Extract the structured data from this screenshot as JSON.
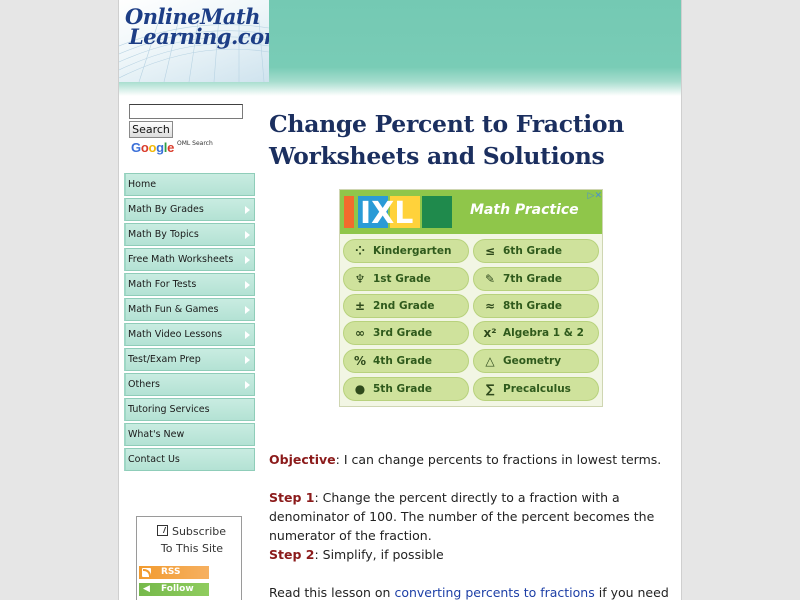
{
  "header": {
    "logo_line1": "OnlineMath",
    "logo_line2": "Learning.com"
  },
  "search": {
    "input_value": "",
    "placeholder": "",
    "button_label": "Search",
    "google_letters": [
      "G",
      "o",
      "o",
      "g",
      "l",
      "e"
    ],
    "google_sub": "OML Search"
  },
  "nav": {
    "items": [
      {
        "label": "Home",
        "has_arrow": false
      },
      {
        "label": "Math By Grades",
        "has_arrow": true
      },
      {
        "label": "Math By Topics",
        "has_arrow": true
      },
      {
        "label": "Free Math Worksheets",
        "has_arrow": true
      },
      {
        "label": "Math For Tests",
        "has_arrow": true
      },
      {
        "label": "Math Fun & Games",
        "has_arrow": true
      },
      {
        "label": "Math Video Lessons",
        "has_arrow": true
      },
      {
        "label": "Test/Exam Prep",
        "has_arrow": true
      },
      {
        "label": "Others",
        "has_arrow": true
      },
      {
        "label": "Tutoring Services",
        "has_arrow": false
      },
      {
        "label": "What's New",
        "has_arrow": false
      },
      {
        "label": "Contact Us",
        "has_arrow": false
      }
    ]
  },
  "subscribe": {
    "line1": "Subscribe",
    "line2": "To This Site",
    "rss_label": "RSS",
    "follow_label": "Follow"
  },
  "main": {
    "title_line1": "Change Percent to Fraction",
    "title_line2": "Worksheets and Solutions"
  },
  "ad": {
    "brand": "IXL",
    "title": "Math Practice",
    "choices_icon": "▷✕",
    "colors": {
      "header": "#8fc64a",
      "cell": "#cfe29c",
      "cell_text": "#2f5a1c"
    },
    "left": [
      {
        "icon": "dots-icon",
        "glyph": "⁘",
        "label": "Kindergarten"
      },
      {
        "icon": "crayons-icon",
        "glyph": "♆",
        "label": "1st Grade"
      },
      {
        "icon": "plus-minus-icon",
        "glyph": "±",
        "label": "2nd Grade"
      },
      {
        "icon": "infinity-icon",
        "glyph": "∞",
        "label": "3rd Grade"
      },
      {
        "icon": "percent-icon",
        "glyph": "%",
        "label": "4th Grade"
      },
      {
        "icon": "apple-icon",
        "glyph": "●",
        "label": "5th Grade"
      }
    ],
    "right": [
      {
        "icon": "less-equal-icon",
        "glyph": "≤",
        "label": "6th Grade"
      },
      {
        "icon": "pencil-icon",
        "glyph": "✎",
        "label": "7th Grade"
      },
      {
        "icon": "approx-icon",
        "glyph": "≈",
        "label": "8th Grade"
      },
      {
        "icon": "x-squared-icon",
        "glyph": "x²",
        "label": "Algebra 1 & 2"
      },
      {
        "icon": "triangle-icon",
        "glyph": "△",
        "label": "Geometry"
      },
      {
        "icon": "sigma-icon",
        "glyph": "∑",
        "label": "Precalculus"
      }
    ]
  },
  "body": {
    "objective_label": "Objective",
    "objective_text": ": I can change percents to fractions in lowest terms.",
    "step1_label": "Step 1",
    "step1_text": ": Change the percent directly to a fraction with a denominator of 100. The number of the percent becomes the numerator of the fraction.",
    "step2_label": "Step 2",
    "step2_text": ": Simplify, if possible",
    "read_prefix": "Read this lesson on ",
    "read_link": "converting percents to fractions",
    "read_suffix": " if you need"
  },
  "colors": {
    "banner": "#79ccb6",
    "title": "#1b2f5f",
    "label_red": "#8b1a1a",
    "link": "#1d3fa6",
    "nav_bg": "#bfe7da"
  }
}
